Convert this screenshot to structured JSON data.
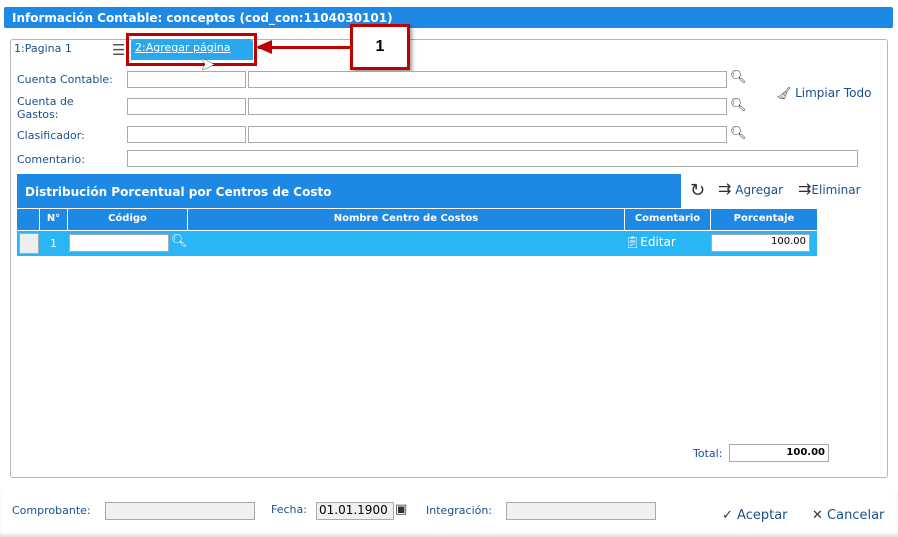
{
  "title": "Información Contable: conceptos (cod_con:1104030101)",
  "tabs": [
    {
      "label": "1:Pagina 1"
    },
    {
      "label": "2:Agregar página"
    }
  ],
  "callout": "1",
  "form": {
    "cuenta_contable": "Cuenta Contable:",
    "cuenta_gastos": "Cuenta de Gastos:",
    "clasificador": "Clasificador:",
    "comentario": "Comentario:",
    "limpiar": "Limpiar Todo"
  },
  "grid": {
    "title": "Distribución Porcentual por Centros de Costo",
    "agregar": "Agregar",
    "eliminar": "Eliminar",
    "columns": [
      "N°",
      "Código",
      "Nombre Centro de Costos",
      "Comentario",
      "Porcentaje"
    ],
    "rows": [
      {
        "n": "1",
        "codigo": "",
        "nombre": "",
        "comentario": "Editar",
        "porcentaje": "100.00"
      }
    ],
    "total_label": "Total:",
    "total": "100.00"
  },
  "footer": {
    "comprobante": "Comprobante:",
    "fecha": "Fecha:",
    "fecha_value": "01.01.1900",
    "integracion": "Integración:",
    "aceptar": "Aceptar",
    "cancelar": "Cancelar"
  }
}
